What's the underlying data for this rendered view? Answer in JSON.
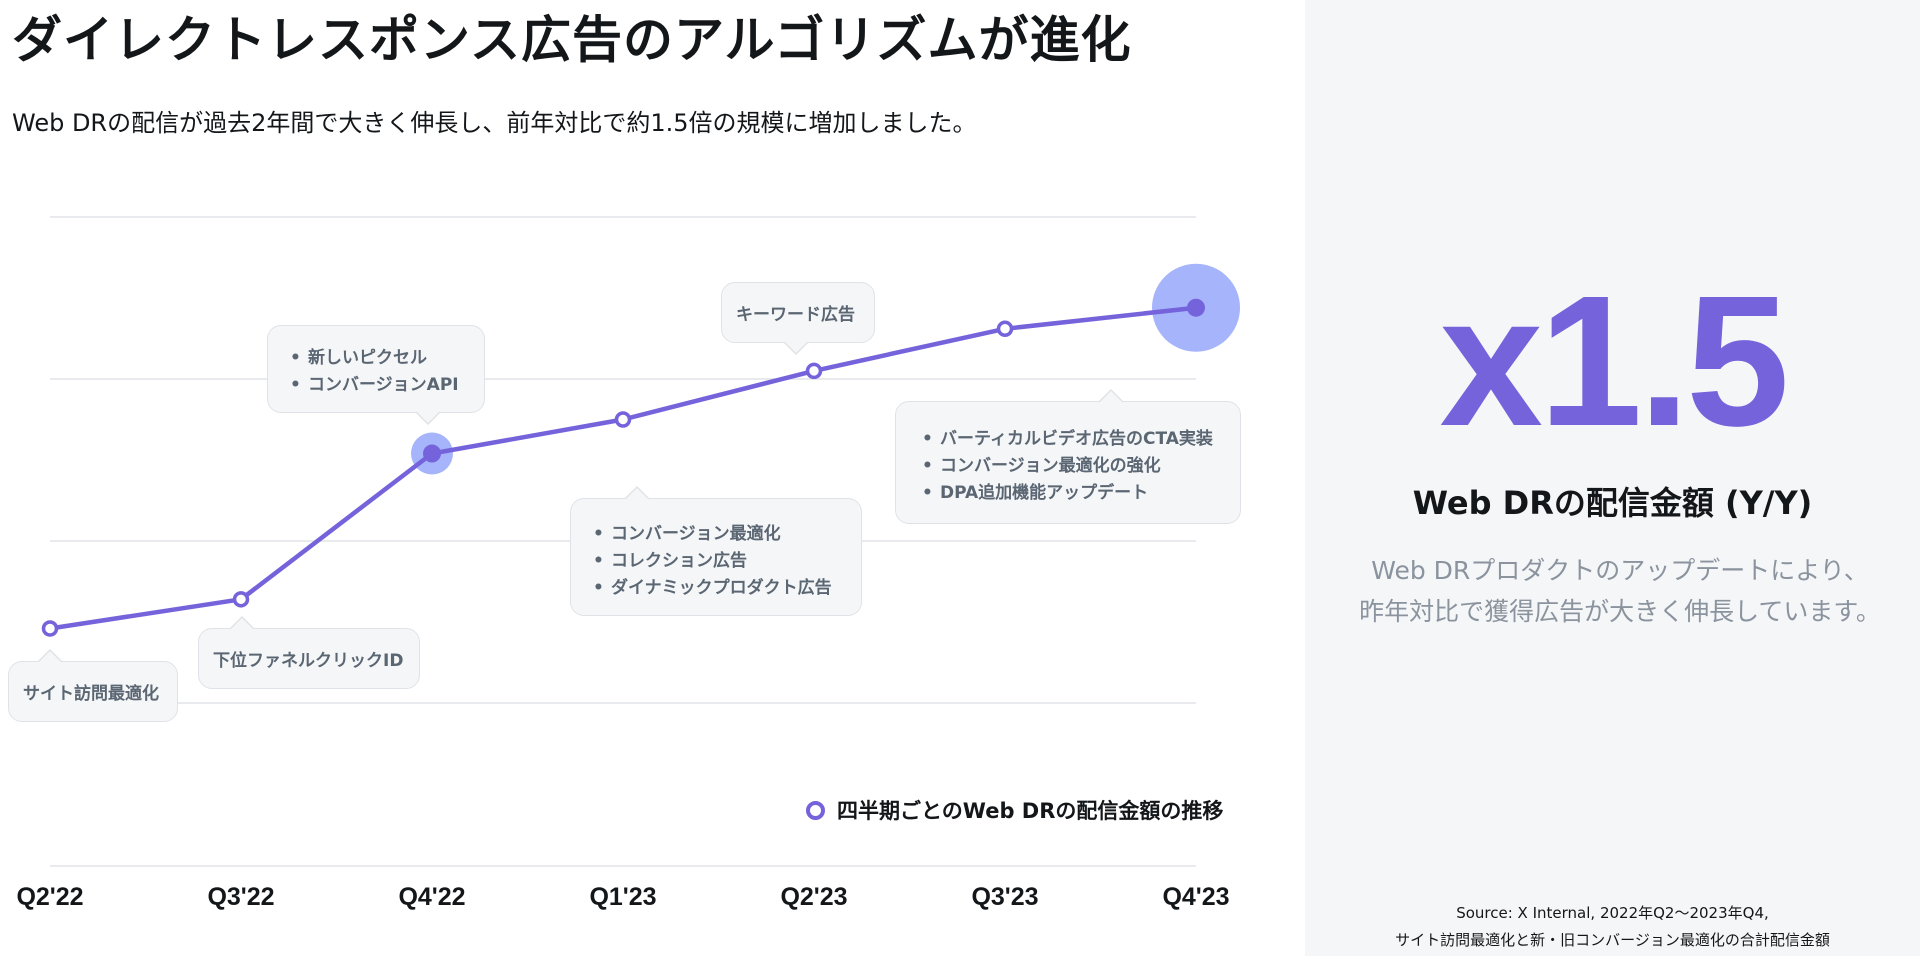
{
  "header": {
    "title": "ダイレクトレスポンス広告のアルゴリズムが進化",
    "subtitle": "Web DRの配信が過去2年間で大きく伸長し、前年対比で約1.5倍の規模に増加しました。"
  },
  "chart_data": {
    "type": "line",
    "categories": [
      "Q2'22",
      "Q3'22",
      "Q4'22",
      "Q1'23",
      "Q2'23",
      "Q3'23",
      "Q4'23"
    ],
    "series": [
      {
        "name": "四半期ごとのWeb DRの配信金額の推移",
        "values": [
          0.46,
          0.64,
          1.54,
          1.75,
          2.05,
          2.31,
          2.44
        ]
      }
    ],
    "ylim": [
      0,
      3
    ],
    "grid": true,
    "legend_position": "bottom-right",
    "highlighted_points": [
      "Q4'22",
      "Q4'23"
    ],
    "annotations": [
      {
        "category": "Q2'22",
        "items": [
          "サイト訪問最適化"
        ]
      },
      {
        "category": "Q3'22",
        "items": [
          "下位ファネルクリックID"
        ]
      },
      {
        "category": "Q4'22",
        "items": [
          "新しいピクセル",
          "コンバージョンAPI"
        ]
      },
      {
        "category": "Q1'23",
        "items": [
          "コンバージョン最適化",
          "コレクション広告",
          "ダイナミックプロダクト広告"
        ]
      },
      {
        "category": "Q2'23",
        "items": [
          "キーワード広告"
        ]
      },
      {
        "category": "Q4'23",
        "items": [
          "バーティカルビデオ広告のCTA実装",
          "コンバージョン最適化の強化",
          "DPA追加機能アップデート"
        ]
      }
    ],
    "colors": {
      "line": "#7563db",
      "highlight": "#a6b4fb",
      "grid": "#e1e4e8"
    }
  },
  "kpi": {
    "value": "x1.5",
    "label": "Web DRの配信金額 (Y/Y)",
    "description": [
      "Web DRプロダクトのアップデートにより、",
      "昨年対比で獲得広告が大きく伸長しています。"
    ]
  },
  "source": {
    "lines": [
      "Source: X Internal, 2022年Q2～2023年Q4,",
      "サイト訪問最適化と新・旧コンバージョン最適化の合計配信金額"
    ]
  }
}
